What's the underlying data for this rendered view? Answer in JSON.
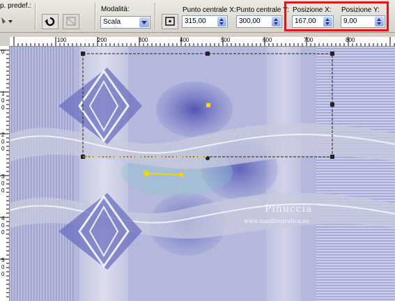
{
  "toolbar": {
    "preset_label": "p. predef.:",
    "mode_label": "Modalità:",
    "mode_value": "Scala",
    "center_x_label": "Punto centrale X:",
    "center_x_value": "315,00",
    "center_y_label": "Punto centrale Y:",
    "center_y_value": "300,00",
    "pos_x_label": "Posizione X:",
    "pos_x_value": "167,00",
    "pos_y_label": "Posizione Y:",
    "pos_y_value": "9,00"
  },
  "ruler": {
    "h_labels": [
      "100",
      "200",
      "300",
      "400",
      "500",
      "600",
      "700",
      "800"
    ],
    "v_labels": [
      "0",
      "1",
      "0",
      "0",
      "2",
      "0",
      "0",
      "3",
      "0",
      "0",
      "4",
      "0",
      "0",
      "5",
      "0",
      "0"
    ]
  },
  "canvas": {
    "watermark": "Pinuccia",
    "watermark_url": "www.maidiregrafica.eu"
  },
  "colors": {
    "highlight": "#e0151e",
    "canvas_base": "#a9aed6"
  }
}
